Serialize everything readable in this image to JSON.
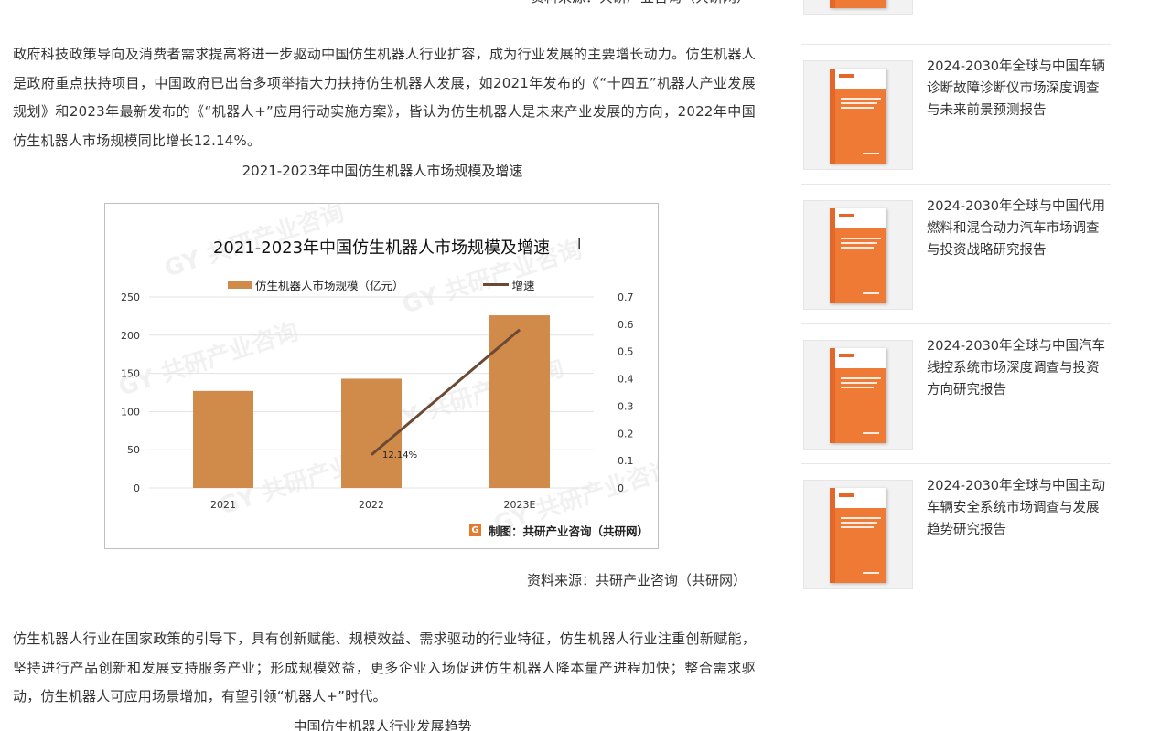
{
  "article": {
    "source_top": "资料来源：共研产业咨询（共研网）",
    "para1": "政府科技政策导向及消费者需求提高将进一步驱动中国仿生机器人行业扩容，成为行业发展的主要增长动力。仿生机器人是政府重点扶持项目，中国政府已出台多项举措大力扶持仿生机器人发展，如2021年发布的《“十四五”机器人产业发展规划》和2023年最新发布的《“机器人+”应用行动实施方案》，皆认为仿生机器人是未来产业发展的方向，2022年中国仿生机器人市场规模同比增长12.14%。",
    "chart_caption": "2021-2023年中国仿生机器人市场规模及增速",
    "source_bottom": "资料来源：共研产业咨询（共研网）",
    "para2": "仿生机器人行业在国家政策的引导下，具有创新赋能、规模效益、需求驱动的行业特征，仿生机器人行业注重创新赋能，坚持进行产品创新和发展支持服务产业；形成规模效益，更多企业入场促进仿生机器人降本量产进程加快；整合需求驱动，仿生机器人可应用场景增加，有望引领“机器人+”时代。",
    "next_caption": "中国仿生机器人行业发展趋势"
  },
  "chart_data": {
    "type": "bar",
    "title": "2021-2023年中国仿生机器人市场规模及增速",
    "categories": [
      "2021",
      "2022",
      "2023E"
    ],
    "series": [
      {
        "name": "仿生机器人市场规模（亿元）",
        "type": "bar",
        "axis": "left",
        "color": "#d08a4a",
        "values": [
          127,
          143,
          226
        ]
      },
      {
        "name": "增速",
        "type": "line",
        "axis": "right",
        "color": "#6b4a35",
        "values": [
          null,
          0.1214,
          0.58
        ]
      }
    ],
    "data_labels": [
      "12.14%"
    ],
    "y_left": {
      "min": 0,
      "max": 250,
      "ticks": [
        "0",
        "50",
        "100",
        "150",
        "200",
        "250"
      ]
    },
    "y_right": {
      "min": 0,
      "max": 0.7,
      "ticks": [
        "0",
        "0.1",
        "0.2",
        "0.3",
        "0.4",
        "0.5",
        "0.6",
        "0.7"
      ]
    },
    "grid": true,
    "legend": "top",
    "credit": "制图：共研产业咨询（共研网）",
    "watermark": "共研产业咨询"
  },
  "sidebar": {
    "items": [
      {
        "title": "2024-2030年全球与中国车辆诊断故障诊断仪市场深度调查与未来前景预测报告"
      },
      {
        "title": "2024-2030年全球与中国代用燃料和混合动力汽车市场调查与投资战略研究报告"
      },
      {
        "title": "2024-2030年全球与中国汽车线控系统市场深度调查与投资方向研究报告"
      },
      {
        "title": "2024-2030年全球与中国主动车辆安全系统市场调查与发展趋势研究报告"
      }
    ]
  },
  "colors": {
    "bar": "#d08a4a",
    "line": "#6b4a35",
    "accent": "#e4672a"
  }
}
